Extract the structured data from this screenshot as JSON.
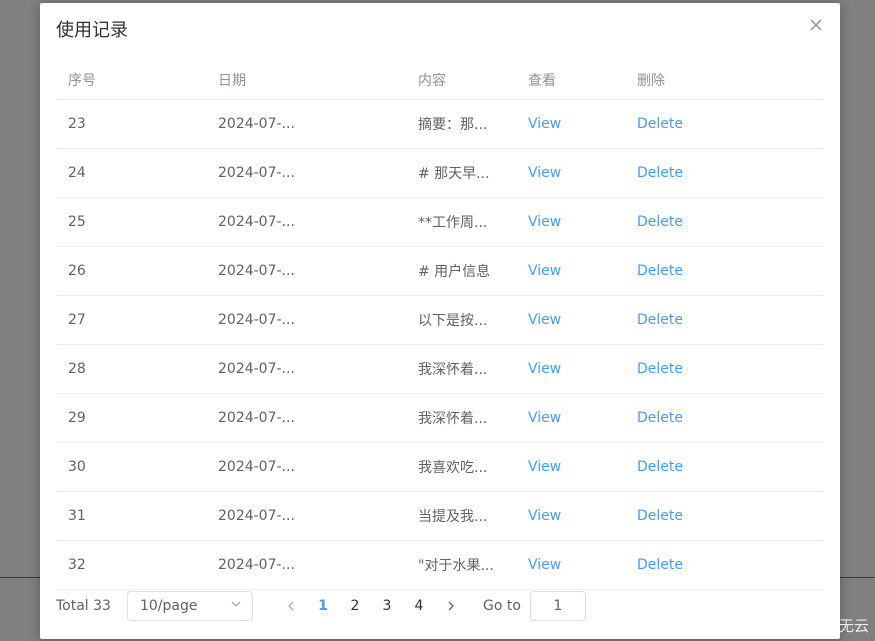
{
  "dialog": {
    "title": "使用记录"
  },
  "table": {
    "headers": {
      "id": "序号",
      "date": "日期",
      "content": "内容",
      "view": "查看",
      "delete": "删除"
    },
    "rows": [
      {
        "id": "23",
        "date": "2024-07-...",
        "content": "摘要：那...",
        "view": "View",
        "delete": "Delete"
      },
      {
        "id": "24",
        "date": "2024-07-...",
        "content": "# 那天早...",
        "view": "View",
        "delete": "Delete"
      },
      {
        "id": "25",
        "date": "2024-07-...",
        "content": "**工作周...",
        "view": "View",
        "delete": "Delete"
      },
      {
        "id": "26",
        "date": "2024-07-...",
        "content": "# 用户信息",
        "view": "View",
        "delete": "Delete"
      },
      {
        "id": "27",
        "date": "2024-07-...",
        "content": "以下是按...",
        "view": "View",
        "delete": "Delete"
      },
      {
        "id": "28",
        "date": "2024-07-...",
        "content": "我深怀着...",
        "view": "View",
        "delete": "Delete"
      },
      {
        "id": "29",
        "date": "2024-07-...",
        "content": "我深怀着...",
        "view": "View",
        "delete": "Delete"
      },
      {
        "id": "30",
        "date": "2024-07-...",
        "content": "我喜欢吃...",
        "view": "View",
        "delete": "Delete"
      },
      {
        "id": "31",
        "date": "2024-07-...",
        "content": "当提及我...",
        "view": "View",
        "delete": "Delete"
      },
      {
        "id": "32",
        "date": "2024-07-...",
        "content": "\"对于水果...",
        "view": "View",
        "delete": "Delete"
      }
    ]
  },
  "pagination": {
    "total": "Total 33",
    "page_size": "10/page",
    "pages": [
      "1",
      "2",
      "3",
      "4"
    ],
    "current_page": "1",
    "goto_label": "Go to",
    "goto_value": "1"
  },
  "watermark": "CSDN @随风万里无云",
  "colors": {
    "primary": "#409eff",
    "text": "#606266",
    "header_text": "#909399",
    "border": "#ebeef5"
  }
}
